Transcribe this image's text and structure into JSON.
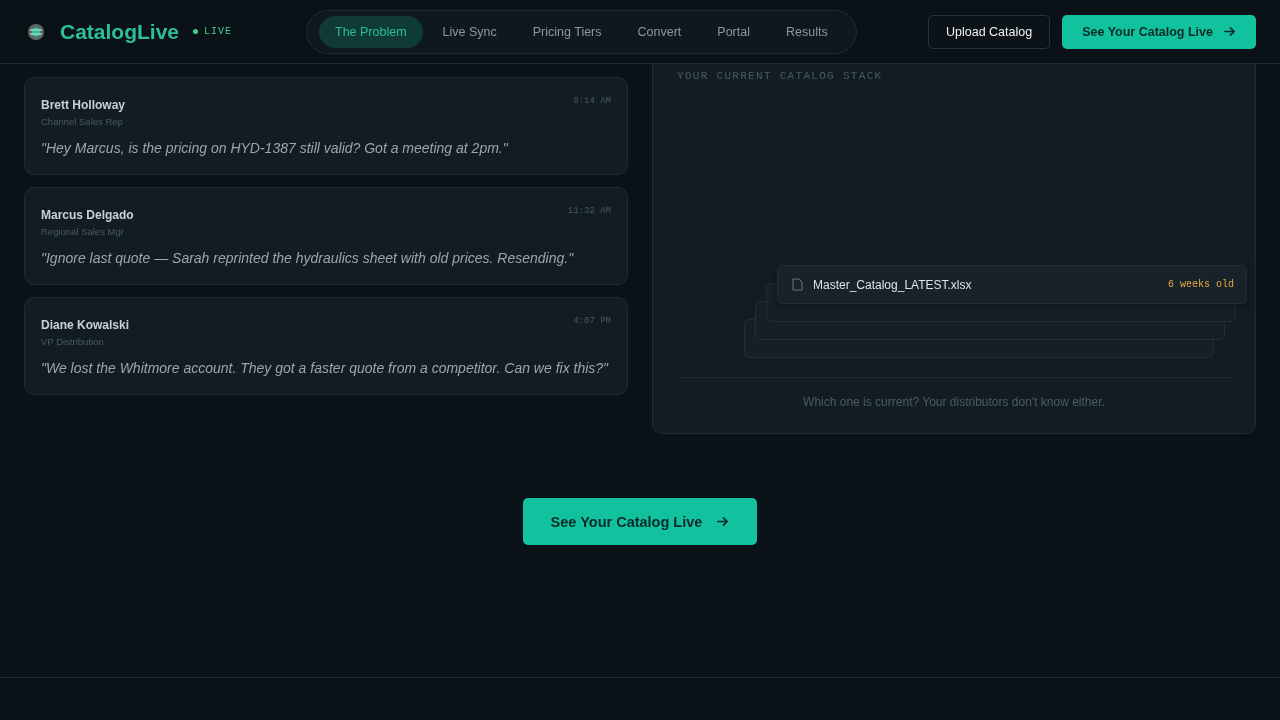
{
  "header": {
    "brand": "CatalogLive",
    "live_badge": "LIVE",
    "nav": [
      {
        "label": "The Problem",
        "selected": true
      },
      {
        "label": "Live Sync",
        "selected": false
      },
      {
        "label": "Pricing Tiers",
        "selected": false
      },
      {
        "label": "Convert",
        "selected": false
      },
      {
        "label": "Portal",
        "selected": false
      },
      {
        "label": "Results",
        "selected": false
      }
    ],
    "buttons": [
      {
        "label": "Upload Catalog",
        "kind": "secondary"
      },
      {
        "label": "See Your Catalog Live",
        "kind": "primary"
      }
    ]
  },
  "messages": [
    {
      "name": "Brett Holloway",
      "role": "Channel Sales Rep",
      "time": "9:14 AM",
      "text": "\"Hey Marcus, is the pricing on HYD-1387 still valid? Got a meeting at 2pm.\""
    },
    {
      "name": "Marcus Delgado",
      "role": "Regional Sales Mgr",
      "time": "11:32 AM",
      "text": "\"Ignore last quote — Sarah reprinted the hydraulics sheet with old prices. Resending.\""
    },
    {
      "name": "Diane Kowalski",
      "role": "VP Distribution",
      "time": "4:07 PM",
      "text": "\"We lost the Whitmore account. They got a faster quote from a competitor. Can we fix this?\""
    }
  ],
  "catalog_stack": {
    "label": "YOUR CURRENT CATALOG STACK",
    "files": [
      {
        "kind": "front",
        "name": "Master_Catalog_LATEST.xlsx",
        "age": "6 weeks old"
      },
      {
        "kind": "covered"
      },
      {
        "kind": "covered"
      },
      {
        "kind": "covered"
      }
    ],
    "caption": "Which one is current? Your distributors don't know either."
  },
  "cta": {
    "label": "See Your Catalog Live"
  }
}
